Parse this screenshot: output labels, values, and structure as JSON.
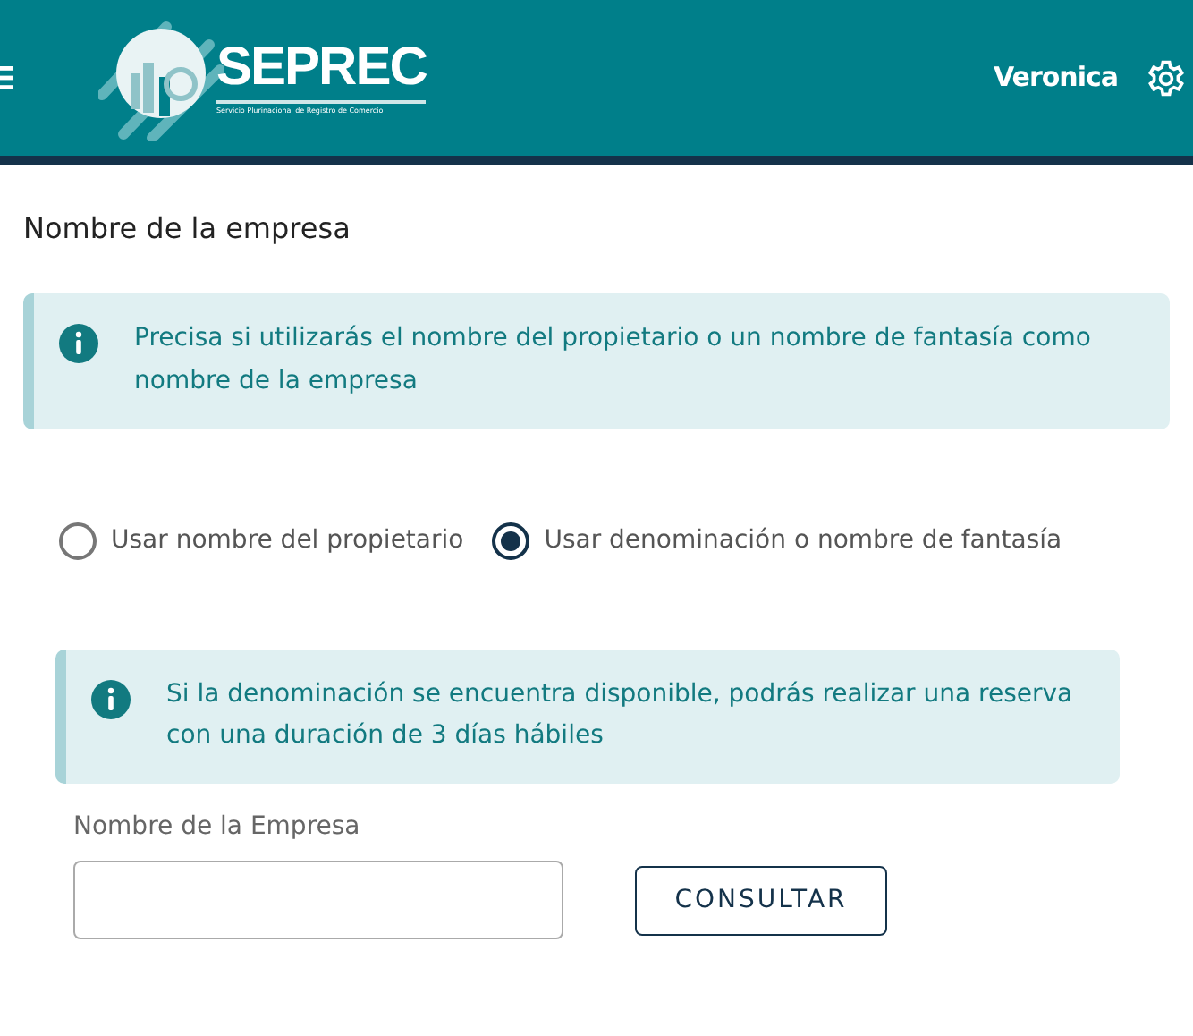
{
  "header": {
    "logo_title": "SEPREC",
    "logo_subtitle": "Servicio Plurinacional de Registro de Comercio",
    "user_name": "Veronica"
  },
  "section_title": "Nombre de la empresa",
  "alerts": [
    {
      "text": "Precisa si utilizarás el nombre del propietario o un nombre de fantasía como nombre de la empresa"
    },
    {
      "text": "Si la denominación se encuentra disponible, podrás realizar una reserva con una duración de 3 días hábiles"
    }
  ],
  "options": [
    {
      "label": "Usar nombre del propietario",
      "selected": false
    },
    {
      "label": "Usar denominación o nombre de fantasía",
      "selected": true
    }
  ],
  "field": {
    "label": "Nombre de la Empresa"
  },
  "button": "CONSULTAR"
}
